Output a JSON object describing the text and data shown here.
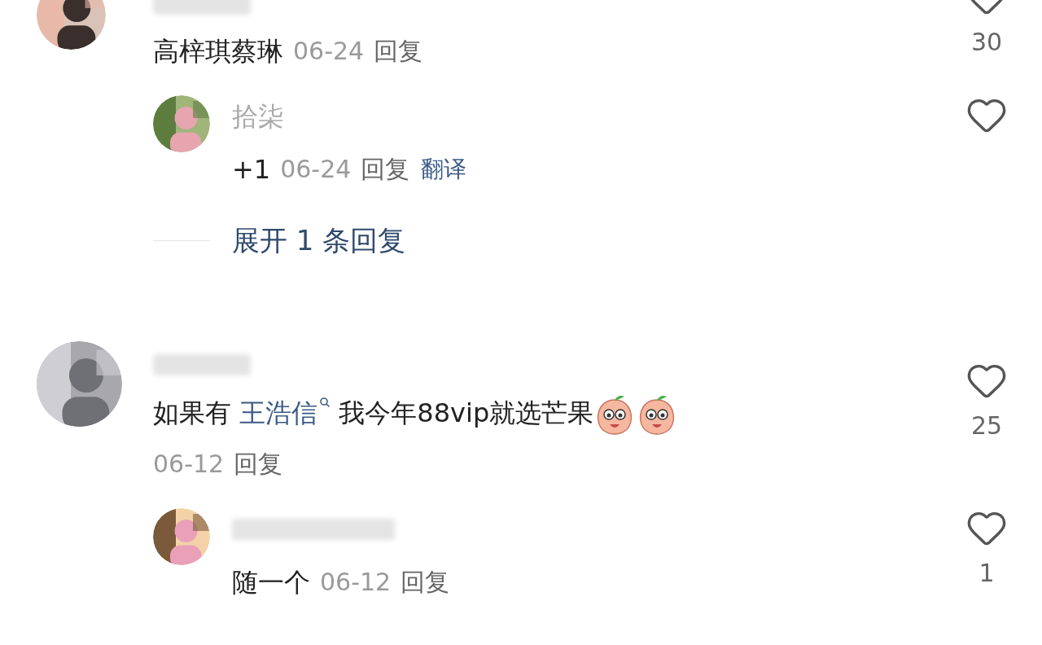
{
  "comments": [
    {
      "segments": [
        {
          "kind": "text",
          "text": "高梓琪蔡琳"
        }
      ],
      "date": "06-24",
      "reply_label": "回复",
      "likes": "30",
      "liked": false,
      "replies": [
        {
          "name": "拾柒",
          "segments": [
            {
              "kind": "text",
              "text": "+1"
            }
          ],
          "date": "06-24",
          "reply_label": "回复",
          "translate": "翻译",
          "liked": false
        }
      ],
      "expand": "展开 1 条回复"
    },
    {
      "segments": [
        {
          "kind": "text",
          "text": "如果有 "
        },
        {
          "kind": "link",
          "text": "王浩信"
        },
        {
          "kind": "text",
          "text": " 我今年88vip就选芒果"
        },
        {
          "kind": "emoji"
        },
        {
          "kind": "emoji"
        }
      ],
      "date": "06-12",
      "reply_label": "回复",
      "likes": "25",
      "liked": false,
      "replies": [
        {
          "segments": [
            {
              "kind": "text",
              "text": "随一个"
            }
          ],
          "date": "06-12",
          "reply_label": "回复",
          "likes": "1",
          "liked": false
        }
      ]
    }
  ]
}
